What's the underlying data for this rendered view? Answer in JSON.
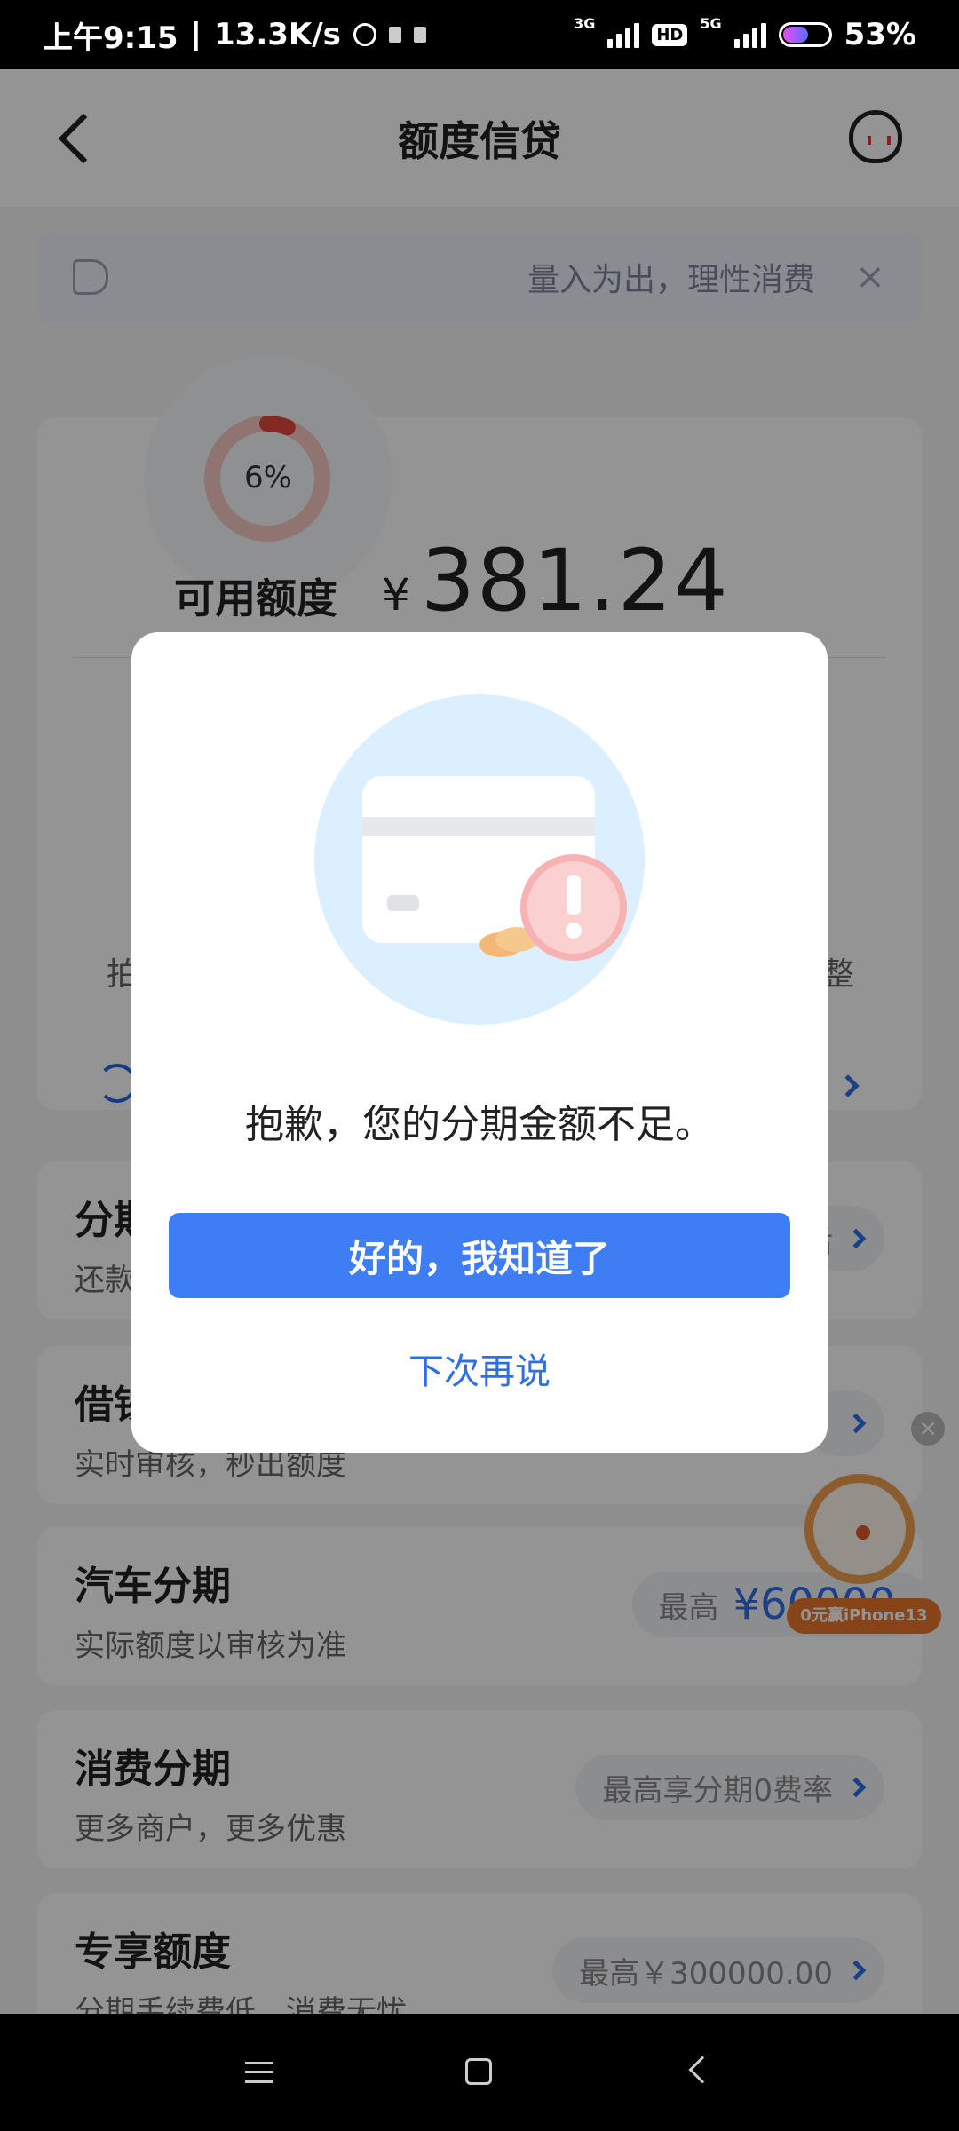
{
  "status_bar": {
    "time": "上午9:15",
    "speed": "13.3K/s",
    "net1": "3G",
    "hd": "HD",
    "net2": "5G",
    "battery_text": "53%",
    "battery_level": 0.53
  },
  "header": {
    "title": "额度信贷"
  },
  "notice": {
    "text": "量入为出，理性消费"
  },
  "credit": {
    "percent_text": "6%",
    "percent": 6,
    "available_label": "可用额度",
    "currency": "¥",
    "amount": "381.24",
    "partial_left": "拍",
    "partial_right": "整"
  },
  "cards": [
    {
      "title": "分期",
      "subtitle": "还款",
      "pill_text": "",
      "pill_value": "",
      "pill_partial": "后"
    },
    {
      "title": "借钱",
      "subtitle": "实时审核，秒出额度",
      "pill_text": "",
      "pill_value": "",
      "pill_partial": ""
    },
    {
      "title": "汽车分期",
      "subtitle": "实际额度以审核为准",
      "pill_text": "最高",
      "pill_value": "¥60000.",
      "pill_partial": ""
    },
    {
      "title": "消费分期",
      "subtitle": "更多商户，更多优惠",
      "pill_text": "最高享分期0费率",
      "pill_value": "",
      "pill_partial": ""
    },
    {
      "title": "专享额度",
      "subtitle": "分期手续费低，消费无忧",
      "pill_text": "最高￥300000.00",
      "pill_value": "",
      "pill_partial": ""
    }
  ],
  "floating": {
    "label": "0元赢iPhone13"
  },
  "modal": {
    "message": "抱歉，您的分期金额不足。",
    "primary_button": "好的，我知道了",
    "secondary_link": "下次再说"
  },
  "colors": {
    "accent": "#3f7df5",
    "link": "#2f6fe6",
    "ring": "#e2453b",
    "warning": "#f06a6a"
  }
}
